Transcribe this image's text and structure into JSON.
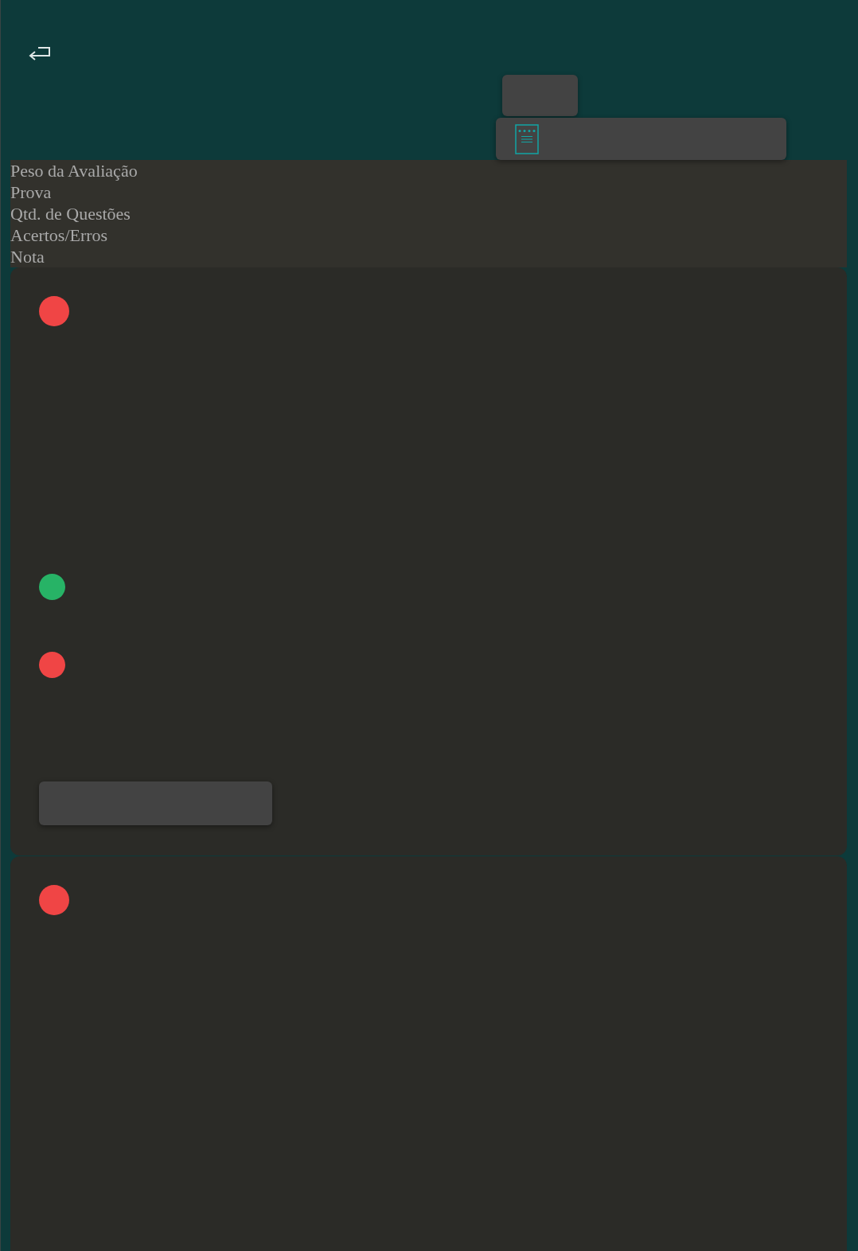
{
  "summary": {
    "labels": [
      "Peso da Avaliação",
      "Prova",
      "Qtd. de Questões",
      "Acertos/Erros",
      "Nota"
    ]
  },
  "cards": [
    {
      "items": [
        {
          "kind": "status",
          "color": "#f04545"
        },
        {
          "kind": "answer",
          "color": "#27b366"
        },
        {
          "kind": "answer",
          "color": "#f04545"
        },
        {
          "kind": "field"
        }
      ]
    },
    {
      "items": [
        {
          "kind": "status",
          "color": "#f04545"
        }
      ]
    }
  ]
}
